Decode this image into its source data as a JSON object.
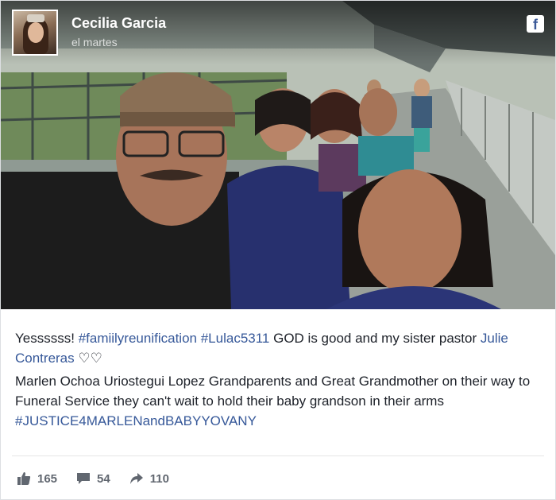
{
  "post": {
    "author": "Cecilia Garcia",
    "timestamp": "el martes",
    "platform_icon": "facebook-icon",
    "text_line1_prefix": "Yessssss! ",
    "tag1": "#famiilyreunification",
    "tag2": "#Lulac5311",
    "text_line1_mid": " GOD is good and my sister pastor ",
    "mention": "Julie Contreras",
    "hearts": " ♡♡",
    "paragraph2": "Marlen Ochoa Uriostegui Lopez Grandparents and Great Grandmother on their way to Funeral Service they can't wait to hold their baby grandson in their arms ",
    "tag3": "#JUSTICE4MARLENandBABYYOVANY"
  },
  "stats": {
    "likes": "165",
    "comments": "54",
    "shares": "110"
  },
  "colors": {
    "link": "#365899",
    "muted": "#616770",
    "text": "#1d2129"
  }
}
